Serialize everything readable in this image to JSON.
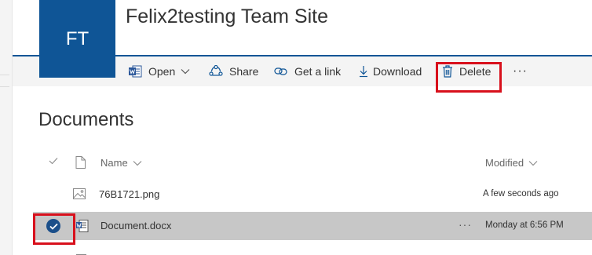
{
  "site": {
    "logo_initials": "FT",
    "title": "Felix2testing Team Site"
  },
  "commands": {
    "open_label": "Open",
    "share_label": "Share",
    "get_link_label": "Get a link",
    "download_label": "Download",
    "delete_label": "Delete",
    "more_label": "···"
  },
  "library": {
    "title": "Documents",
    "columns": {
      "name": "Name",
      "modified": "Modified"
    },
    "files": [
      {
        "name": "76B1721.png",
        "modified": "A few seconds ago",
        "icon": "image-file-icon",
        "selected": false
      },
      {
        "name": "Document.docx",
        "modified": "Monday at 6:56 PM",
        "icon": "word-file-icon",
        "selected": true
      }
    ],
    "row_more_label": "···"
  },
  "colors": {
    "brand": "#0f5596",
    "highlight": "#d8101c",
    "selected_row": "#c7c7c7",
    "command_bar": "#f4f4f4"
  }
}
